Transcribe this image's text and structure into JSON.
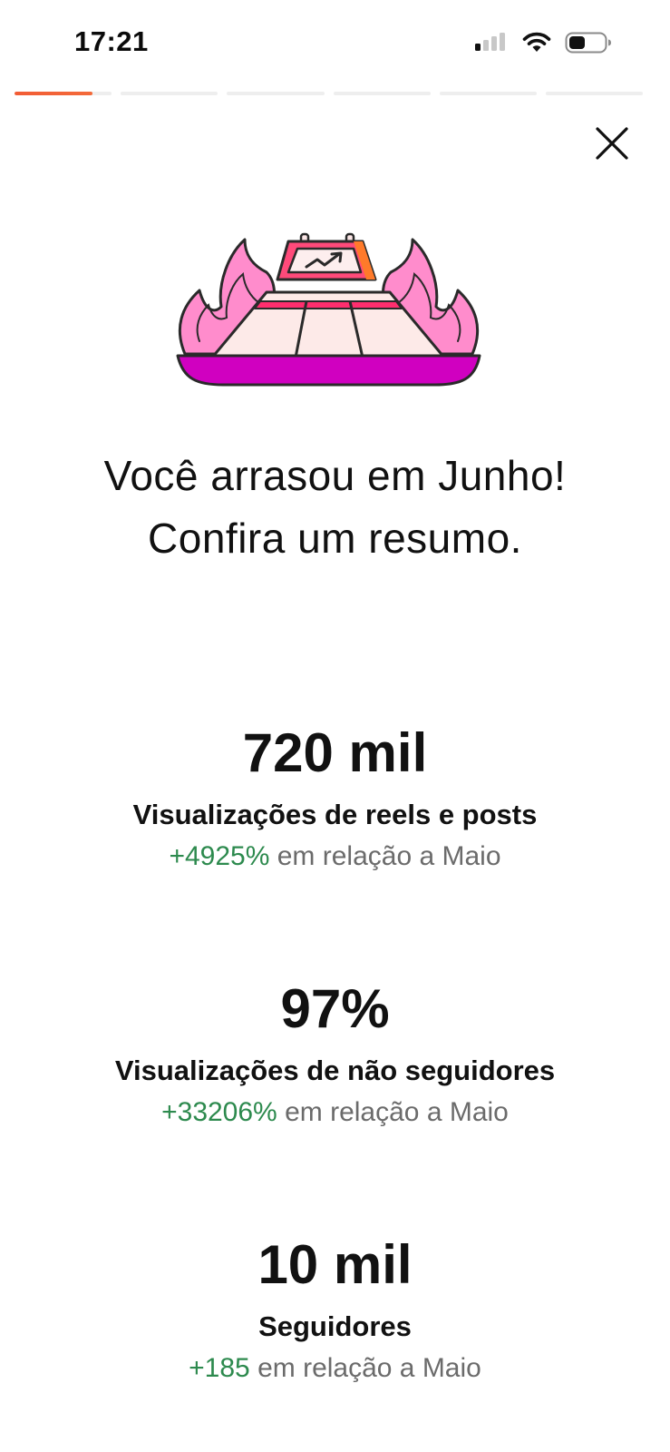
{
  "status_bar": {
    "time": "17:21",
    "battery_level_fraction": 0.45
  },
  "story_progress": {
    "segments": 6,
    "active_segment": 1,
    "active_fill_fraction": 0.8,
    "accent_color": "#f25c35"
  },
  "close_icon": "close-icon",
  "illustration_icon": "trending-chart-on-fire-illustration",
  "headline": "Você arrasou em Junho! Confira um resumo.",
  "stats": [
    {
      "value": "720 mil",
      "label": "Visualizações de reels e posts",
      "change": "+4925%",
      "comparison": "em relação a Maio"
    },
    {
      "value": "97%",
      "label": "Visualizações de não seguidores",
      "change": "+33206%",
      "comparison": "em relação a Maio"
    },
    {
      "value": "10 mil",
      "label": "Seguidores",
      "change": "+185",
      "comparison": "em relação a Maio"
    }
  ],
  "colors": {
    "positive": "#2d8a4e",
    "muted": "#6b6b6b",
    "flame_pink": "#ff8ccc",
    "base_magenta": "#d000c0"
  }
}
